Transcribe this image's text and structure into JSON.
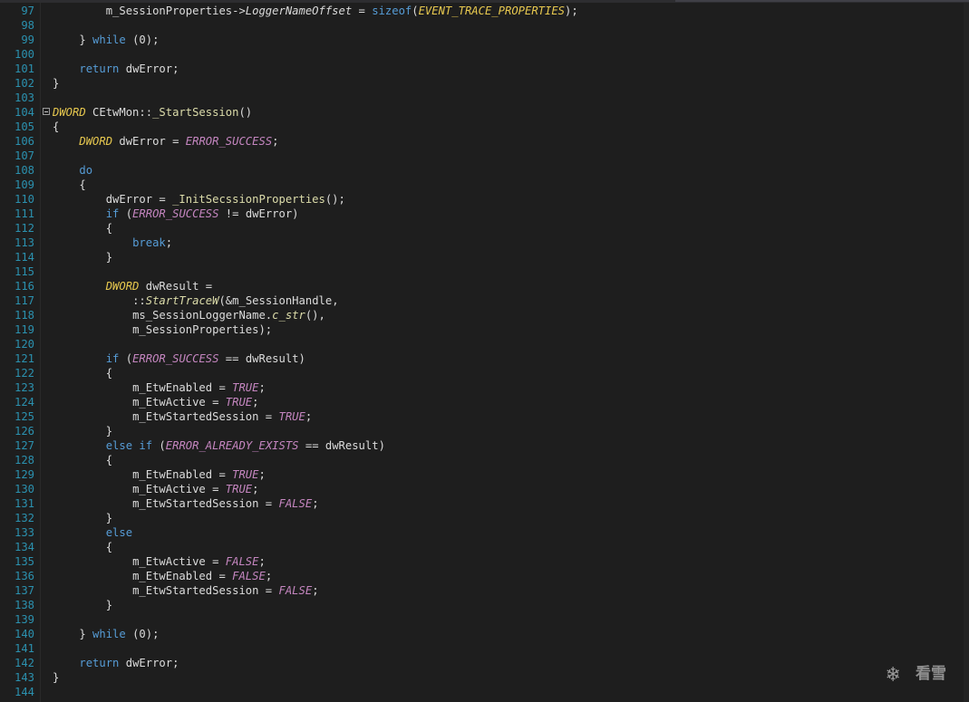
{
  "editor": {
    "lines": [
      {
        "n": "97",
        "fold": false,
        "t": [
          [
            "i",
            "        "
          ],
          [
            "p",
            "m_SessionProperties->"
          ],
          [
            "mem",
            "LoggerNameOffset"
          ],
          [
            "p",
            " = "
          ],
          [
            "k",
            "sizeof"
          ],
          [
            "p",
            "("
          ],
          [
            "t",
            "EVENT_TRACE_PROPERTIES"
          ],
          [
            "p",
            ");"
          ]
        ]
      },
      {
        "n": "98",
        "fold": false,
        "t": []
      },
      {
        "n": "99",
        "fold": false,
        "t": [
          [
            "i",
            "    "
          ],
          [
            "p",
            "} "
          ],
          [
            "k",
            "while"
          ],
          [
            "p",
            " (0);"
          ]
        ]
      },
      {
        "n": "100",
        "fold": false,
        "t": []
      },
      {
        "n": "101",
        "fold": false,
        "t": [
          [
            "i",
            "    "
          ],
          [
            "k",
            "return"
          ],
          [
            "p",
            " dwError;"
          ]
        ]
      },
      {
        "n": "102",
        "fold": false,
        "t": [
          [
            "p",
            "}"
          ]
        ]
      },
      {
        "n": "103",
        "fold": false,
        "t": []
      },
      {
        "n": "104",
        "fold": true,
        "t": [
          [
            "t",
            "DWORD"
          ],
          [
            "p",
            " CEtwMon::"
          ],
          [
            "f",
            "_StartSession"
          ],
          [
            "p",
            "()"
          ]
        ]
      },
      {
        "n": "105",
        "fold": false,
        "t": [
          [
            "p",
            "{"
          ]
        ]
      },
      {
        "n": "106",
        "fold": false,
        "t": [
          [
            "i",
            "    "
          ],
          [
            "t",
            "DWORD"
          ],
          [
            "p",
            " dwError = "
          ],
          [
            "m",
            "ERROR_SUCCESS"
          ],
          [
            "p",
            ";"
          ]
        ]
      },
      {
        "n": "107",
        "fold": false,
        "t": []
      },
      {
        "n": "108",
        "fold": false,
        "t": [
          [
            "i",
            "    "
          ],
          [
            "k",
            "do"
          ]
        ]
      },
      {
        "n": "109",
        "fold": false,
        "t": [
          [
            "i",
            "    "
          ],
          [
            "p",
            "{"
          ]
        ]
      },
      {
        "n": "110",
        "fold": false,
        "t": [
          [
            "i",
            "        "
          ],
          [
            "p",
            "dwError = "
          ],
          [
            "f",
            "_InitSecssionProperties"
          ],
          [
            "p",
            "();"
          ]
        ]
      },
      {
        "n": "111",
        "fold": false,
        "t": [
          [
            "i",
            "        "
          ],
          [
            "k",
            "if"
          ],
          [
            "p",
            " ("
          ],
          [
            "m",
            "ERROR_SUCCESS"
          ],
          [
            "p",
            " != dwError)"
          ]
        ]
      },
      {
        "n": "112",
        "fold": false,
        "t": [
          [
            "i",
            "        "
          ],
          [
            "p",
            "{"
          ]
        ]
      },
      {
        "n": "113",
        "fold": false,
        "t": [
          [
            "i",
            "            "
          ],
          [
            "k",
            "break"
          ],
          [
            "p",
            ";"
          ]
        ]
      },
      {
        "n": "114",
        "fold": false,
        "t": [
          [
            "i",
            "        "
          ],
          [
            "p",
            "}"
          ]
        ]
      },
      {
        "n": "115",
        "fold": false,
        "t": []
      },
      {
        "n": "116",
        "fold": false,
        "t": [
          [
            "i",
            "        "
          ],
          [
            "t",
            "DWORD"
          ],
          [
            "p",
            " dwResult ="
          ]
        ]
      },
      {
        "n": "117",
        "fold": false,
        "t": [
          [
            "i",
            "            "
          ],
          [
            "p",
            "::"
          ],
          [
            "fi",
            "StartTraceW"
          ],
          [
            "p",
            "(&m_SessionHandle,"
          ]
        ]
      },
      {
        "n": "118",
        "fold": false,
        "t": [
          [
            "i",
            "            "
          ],
          [
            "p",
            "ms_SessionLoggerName."
          ],
          [
            "fi",
            "c_str"
          ],
          [
            "p",
            "(),"
          ]
        ]
      },
      {
        "n": "119",
        "fold": false,
        "t": [
          [
            "i",
            "            "
          ],
          [
            "p",
            "m_SessionProperties);"
          ]
        ]
      },
      {
        "n": "120",
        "fold": false,
        "t": []
      },
      {
        "n": "121",
        "fold": false,
        "t": [
          [
            "i",
            "        "
          ],
          [
            "k",
            "if"
          ],
          [
            "p",
            " ("
          ],
          [
            "m",
            "ERROR_SUCCESS"
          ],
          [
            "p",
            " == dwResult)"
          ]
        ]
      },
      {
        "n": "122",
        "fold": false,
        "t": [
          [
            "i",
            "        "
          ],
          [
            "p",
            "{"
          ]
        ]
      },
      {
        "n": "123",
        "fold": false,
        "t": [
          [
            "i",
            "            "
          ],
          [
            "p",
            "m_EtwEnabled = "
          ],
          [
            "m",
            "TRUE"
          ],
          [
            "p",
            ";"
          ]
        ]
      },
      {
        "n": "124",
        "fold": false,
        "t": [
          [
            "i",
            "            "
          ],
          [
            "p",
            "m_EtwActive = "
          ],
          [
            "m",
            "TRUE"
          ],
          [
            "p",
            ";"
          ]
        ]
      },
      {
        "n": "125",
        "fold": false,
        "t": [
          [
            "i",
            "            "
          ],
          [
            "p",
            "m_EtwStartedSession = "
          ],
          [
            "m",
            "TRUE"
          ],
          [
            "p",
            ";"
          ]
        ]
      },
      {
        "n": "126",
        "fold": false,
        "t": [
          [
            "i",
            "        "
          ],
          [
            "p",
            "}"
          ]
        ]
      },
      {
        "n": "127",
        "fold": false,
        "t": [
          [
            "i",
            "        "
          ],
          [
            "k",
            "else if"
          ],
          [
            "p",
            " ("
          ],
          [
            "m",
            "ERROR_ALREADY_EXISTS"
          ],
          [
            "p",
            " == dwResult)"
          ]
        ]
      },
      {
        "n": "128",
        "fold": false,
        "t": [
          [
            "i",
            "        "
          ],
          [
            "p",
            "{"
          ]
        ]
      },
      {
        "n": "129",
        "fold": false,
        "t": [
          [
            "i",
            "            "
          ],
          [
            "p",
            "m_EtwEnabled = "
          ],
          [
            "m",
            "TRUE"
          ],
          [
            "p",
            ";"
          ]
        ]
      },
      {
        "n": "130",
        "fold": false,
        "t": [
          [
            "i",
            "            "
          ],
          [
            "p",
            "m_EtwActive = "
          ],
          [
            "m",
            "TRUE"
          ],
          [
            "p",
            ";"
          ]
        ]
      },
      {
        "n": "131",
        "fold": false,
        "t": [
          [
            "i",
            "            "
          ],
          [
            "p",
            "m_EtwStartedSession = "
          ],
          [
            "m",
            "FALSE"
          ],
          [
            "p",
            ";"
          ]
        ]
      },
      {
        "n": "132",
        "fold": false,
        "t": [
          [
            "i",
            "        "
          ],
          [
            "p",
            "}"
          ]
        ]
      },
      {
        "n": "133",
        "fold": false,
        "t": [
          [
            "i",
            "        "
          ],
          [
            "k",
            "else"
          ]
        ]
      },
      {
        "n": "134",
        "fold": false,
        "t": [
          [
            "i",
            "        "
          ],
          [
            "p",
            "{"
          ]
        ]
      },
      {
        "n": "135",
        "fold": false,
        "t": [
          [
            "i",
            "            "
          ],
          [
            "p",
            "m_EtwActive = "
          ],
          [
            "m",
            "FALSE"
          ],
          [
            "p",
            ";"
          ]
        ]
      },
      {
        "n": "136",
        "fold": false,
        "t": [
          [
            "i",
            "            "
          ],
          [
            "p",
            "m_EtwEnabled = "
          ],
          [
            "m",
            "FALSE"
          ],
          [
            "p",
            ";"
          ]
        ]
      },
      {
        "n": "137",
        "fold": false,
        "t": [
          [
            "i",
            "            "
          ],
          [
            "p",
            "m_EtwStartedSession = "
          ],
          [
            "m",
            "FALSE"
          ],
          [
            "p",
            ";"
          ]
        ]
      },
      {
        "n": "138",
        "fold": false,
        "t": [
          [
            "i",
            "        "
          ],
          [
            "p",
            "}"
          ]
        ]
      },
      {
        "n": "139",
        "fold": false,
        "t": []
      },
      {
        "n": "140",
        "fold": false,
        "t": [
          [
            "i",
            "    "
          ],
          [
            "p",
            "} "
          ],
          [
            "k",
            "while"
          ],
          [
            "p",
            " (0);"
          ]
        ]
      },
      {
        "n": "141",
        "fold": false,
        "t": []
      },
      {
        "n": "142",
        "fold": false,
        "t": [
          [
            "i",
            "    "
          ],
          [
            "k",
            "return"
          ],
          [
            "p",
            " dwError;"
          ]
        ]
      },
      {
        "n": "143",
        "fold": false,
        "t": [
          [
            "p",
            "}"
          ]
        ]
      },
      {
        "n": "144",
        "fold": false,
        "t": []
      }
    ]
  },
  "watermark": {
    "icon": "snowflake-icon",
    "glyph": "❄",
    "text": "看雪"
  },
  "colors": {
    "background": "#1e1e1e",
    "line_number": "#2b91af",
    "keyword": "#569cd6",
    "type": "#e8c94f",
    "macro": "#c586c0",
    "function": "#dcdcaa",
    "plain": "#dcdcdc"
  }
}
